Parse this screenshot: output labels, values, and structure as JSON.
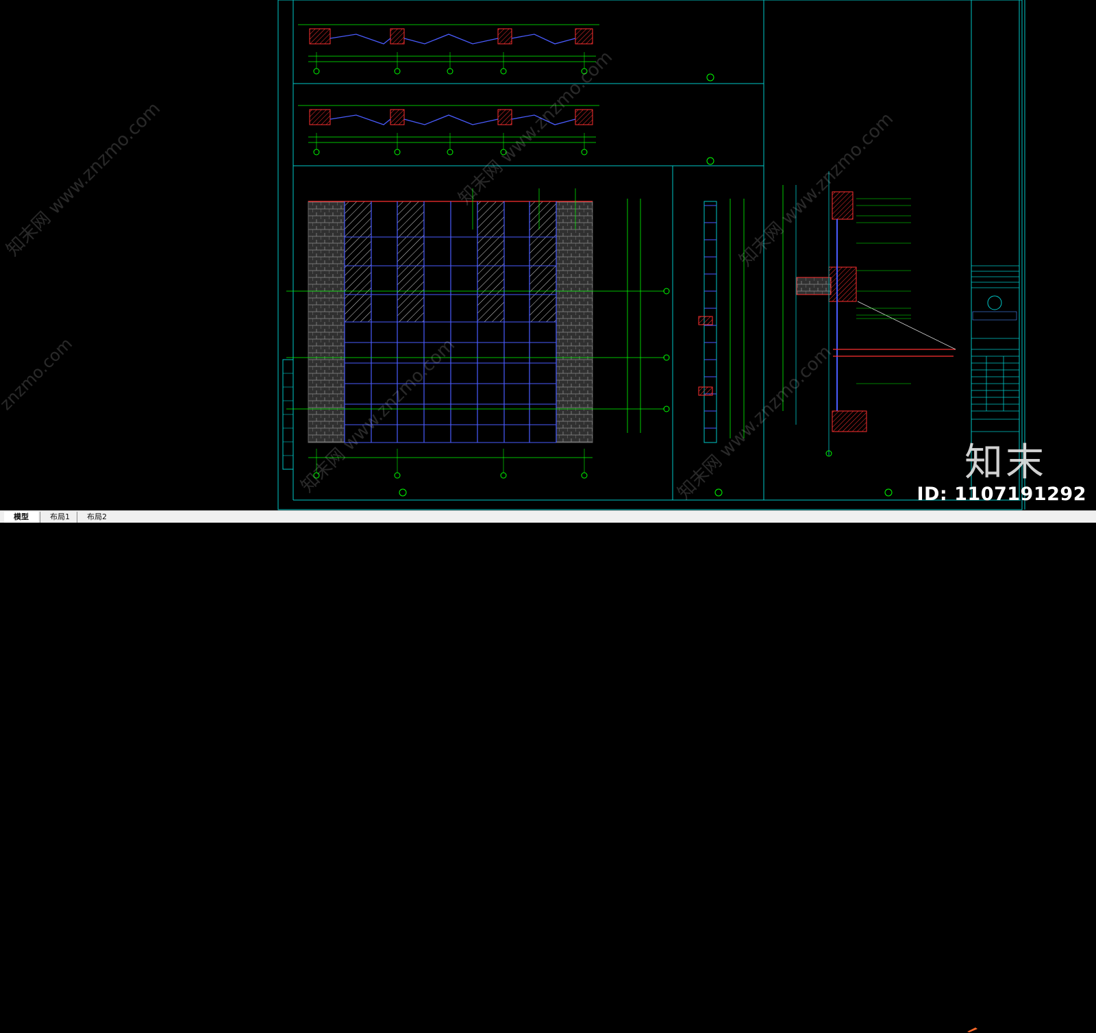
{
  "layout_tabs": [
    {
      "label": "模型",
      "active": true
    },
    {
      "label": "布局1",
      "active": false
    },
    {
      "label": "布局2",
      "active": false
    }
  ],
  "watermark": {
    "site": "www.znzmo.com",
    "site_short": "znzmo.com",
    "brand": "知末网",
    "logo_text": "知末",
    "id_text": "ID: 1107191292"
  },
  "colors": {
    "background": "#000000",
    "frame": "#00c8c8",
    "dimension": "#00ff00",
    "glazing": "#4a5cff",
    "wall_hatch": "#ff3030",
    "text": "#ffffff",
    "tab_bar": "#f0f0f0"
  },
  "icons": {
    "corner": "pencil-icon"
  }
}
